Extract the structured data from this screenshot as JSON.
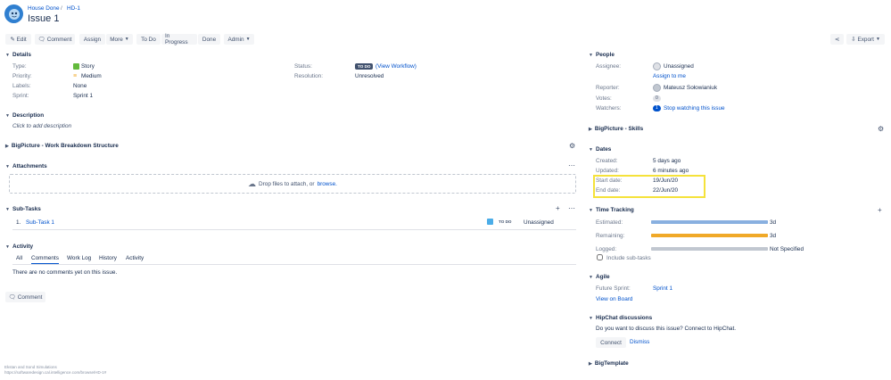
{
  "header": {
    "breadcrumb_project": "House Done",
    "breadcrumb_sep": "/",
    "breadcrumb_issue": "HD-1",
    "title": "Issue 1"
  },
  "toolbar": {
    "edit": "Edit",
    "comment": "Comment",
    "assign": "Assign",
    "more": "More",
    "todo": "To Do",
    "in_progress": "In Progress",
    "done": "Done",
    "admin": "Admin",
    "export": "Export"
  },
  "details": {
    "heading": "Details",
    "type_label": "Type:",
    "type_value": "Story",
    "priority_label": "Priority:",
    "priority_value": "Medium",
    "labels_label": "Labels:",
    "labels_value": "None",
    "sprint_label": "Sprint:",
    "sprint_value": "Sprint 1",
    "status_label": "Status:",
    "status_value": "TO DO",
    "workflow_link": "(View Workflow)",
    "resolution_label": "Resolution:",
    "resolution_value": "Unresolved"
  },
  "description": {
    "heading": "Description",
    "placeholder": "Click to add description"
  },
  "wbs": {
    "heading": "BigPicture - Work Breakdown Structure"
  },
  "attachments": {
    "heading": "Attachments",
    "drop_text": "Drop files to attach, or",
    "browse": "browse."
  },
  "subtasks": {
    "heading": "Sub-Tasks",
    "rows": [
      {
        "num": "1.",
        "name": "Sub-Task 1",
        "status": "TO DO",
        "assignee": "Unassigned"
      }
    ]
  },
  "activity": {
    "heading": "Activity",
    "tabs": [
      "All",
      "Comments",
      "Work Log",
      "History",
      "Activity"
    ],
    "empty": "There are no comments yet on this issue.",
    "comment_button": "Comment"
  },
  "footer": {
    "line1": "Ekstan and Sond Simulations",
    "line2": "https://softwaredesign.cal.intelligence.com/browse/HD-1#"
  },
  "people": {
    "heading": "People",
    "assignee_label": "Assignee:",
    "assignee_value": "Unassigned",
    "assign_to_me": "Assign to me",
    "reporter_label": "Reporter:",
    "reporter_value": "Mateusz Sołowianiuk",
    "votes_label": "Votes:",
    "votes_value": "0",
    "watchers_label": "Watchers:",
    "watchers_count": "1",
    "watchers_link": "Stop watching this issue"
  },
  "skills": {
    "heading": "BigPicture - Skills"
  },
  "dates": {
    "heading": "Dates",
    "created_label": "Created:",
    "created_value": "5 days ago",
    "updated_label": "Updated:",
    "updated_value": "6 minutes ago",
    "start_label": "Start date:",
    "start_value": "19/Jun/20",
    "end_label": "End date:",
    "end_value": "22/Jun/20",
    "highlight_color": "#f5e23b"
  },
  "time_tracking": {
    "heading": "Time Tracking",
    "estimated_label": "Estimated:",
    "estimated_value": "3d",
    "estimated_fill": 1.0,
    "estimated_color": "#89b0e0",
    "remaining_label": "Remaining:",
    "remaining_value": "3d",
    "remaining_fill": 1.0,
    "remaining_color": "#f0a928",
    "logged_label": "Logged:",
    "logged_value": "Not Specified",
    "logged_fill": 0,
    "include_subtasks": "Include sub-tasks"
  },
  "agile": {
    "heading": "Agile",
    "future_sprint_label": "Future Sprint:",
    "future_sprint_value": "Sprint 1",
    "view_on_board": "View on Board"
  },
  "hipchat": {
    "heading": "HipChat discussions",
    "text": "Do you want to discuss this issue? Connect to HipChat.",
    "connect": "Connect",
    "dismiss": "Dismiss"
  },
  "bigtemplate": {
    "heading": "BigTemplate"
  }
}
